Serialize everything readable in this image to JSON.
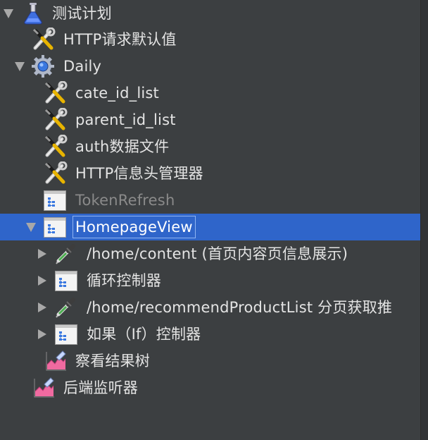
{
  "tree": {
    "nodes": [
      {
        "label": "测试计划",
        "icon": "test-plan-flask-icon",
        "toggle": "expanded"
      },
      {
        "label": "HTTP请求默认值",
        "icon": "config-wrench-icon",
        "toggle": "none"
      },
      {
        "label": "Daily",
        "icon": "thread-group-gear-icon",
        "toggle": "expanded"
      },
      {
        "label": "cate_id_list",
        "icon": "config-wrench-icon",
        "toggle": "none"
      },
      {
        "label": "parent_id_list",
        "icon": "config-wrench-icon",
        "toggle": "none"
      },
      {
        "label": "auth数据文件",
        "icon": "config-wrench-icon",
        "toggle": "none"
      },
      {
        "label": "HTTP信息头管理器",
        "icon": "config-wrench-icon",
        "toggle": "none"
      },
      {
        "label": "TokenRefresh",
        "icon": "controller-window-icon",
        "toggle": "none",
        "state": "disabled"
      },
      {
        "label": "HomepageView",
        "icon": "controller-window-icon",
        "toggle": "expanded",
        "state": "selected"
      },
      {
        "label": "/home/content (首页内容页信息展示)",
        "icon": "sampler-pipette-icon",
        "toggle": "collapsed"
      },
      {
        "label": "循环控制器",
        "icon": "controller-window-icon",
        "toggle": "collapsed"
      },
      {
        "label": "/home/recommendProductList 分页获取推",
        "icon": "sampler-pipette-icon",
        "toggle": "collapsed"
      },
      {
        "label": "如果（If）控制器",
        "icon": "controller-window-icon",
        "toggle": "collapsed"
      },
      {
        "label": "察看结果树",
        "icon": "listener-chart-icon",
        "toggle": "none"
      },
      {
        "label": "后端监听器",
        "icon": "listener-chart-icon",
        "toggle": "none"
      }
    ]
  },
  "colors": {
    "background": "#3c3f41",
    "selection": "#2f65ca",
    "text": "#e4e4e4",
    "disabled_text": "#8a8a8a"
  }
}
